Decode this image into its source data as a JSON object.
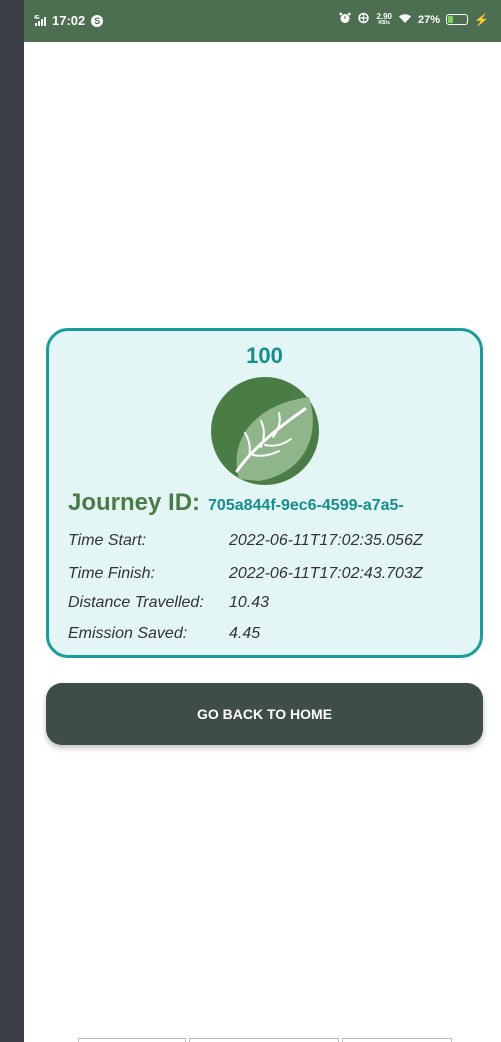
{
  "status_bar": {
    "signal": "4G",
    "time": "17:02",
    "badge": "S",
    "net_speed": "2.90",
    "net_unit": "KB/s",
    "battery": "27%",
    "battery_level": 0.27,
    "icons": [
      "signal-icon",
      "alarm-icon",
      "vibrate-icon",
      "wifi-icon",
      "battery-icon",
      "charging-icon"
    ]
  },
  "card": {
    "score": "100",
    "journey_label": "Journey ID:",
    "journey_id": "705a844f-9ec6-4599-a7a5-",
    "time_start_label": "Time Start:",
    "time_start_value": "2022-06-11T17:02:35.056Z",
    "time_finish_label": "Time Finish:",
    "time_finish_value": "2022-06-11T17:02:43.703Z",
    "distance_label": "Distance Travelled:",
    "distance_value": "10.43",
    "emission_label": "Emission Saved:",
    "emission_value": "4.45"
  },
  "button": {
    "label": "GO BACK TO HOME"
  },
  "colors": {
    "status_bar": "#4d6f51",
    "card_border": "#1a9c9c",
    "card_bg": "#e3f6f5",
    "accent_teal": "#148e8e",
    "journey_green": "#4a7c45",
    "button_bg": "#3e4d48",
    "leaf_dark": "#4a7c45",
    "leaf_light": "#8fb58a"
  }
}
